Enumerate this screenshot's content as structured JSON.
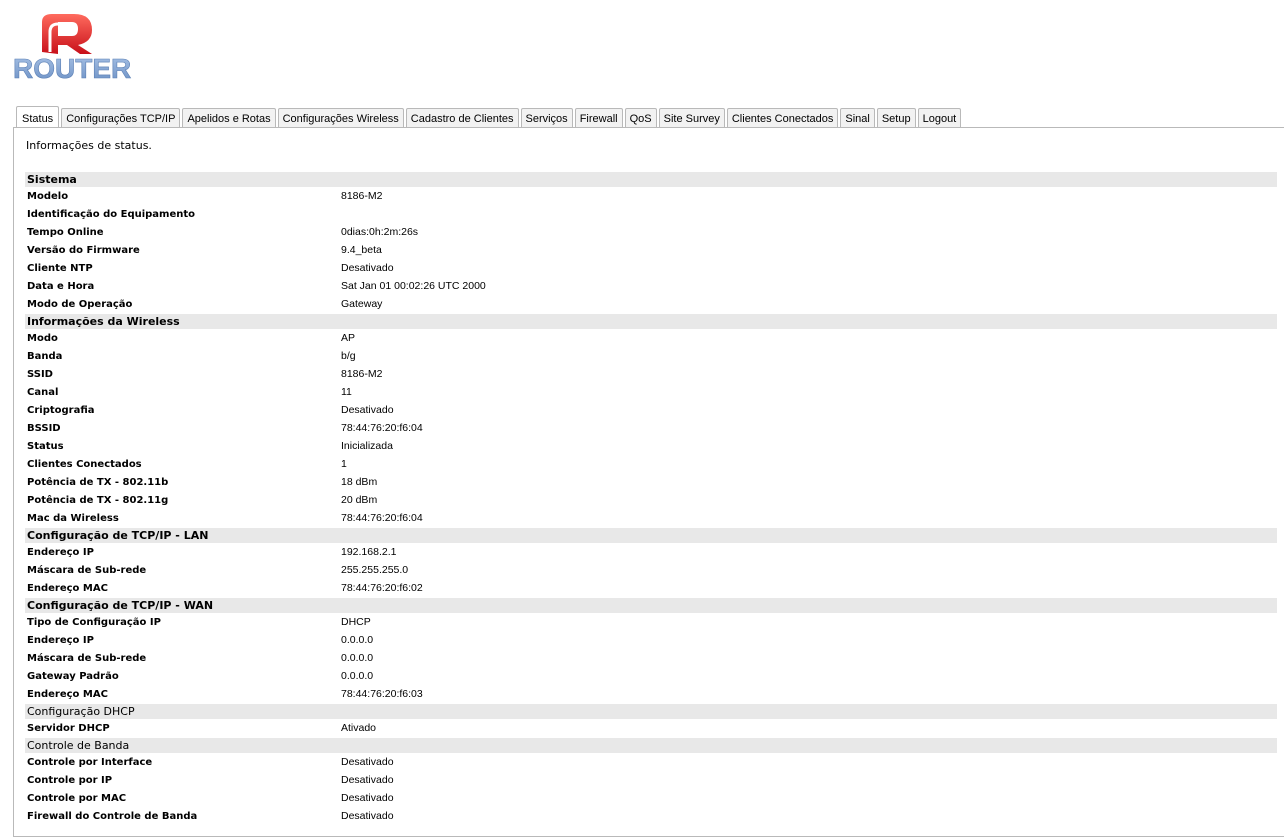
{
  "app": {
    "logo_text": "ROUTER",
    "colors": {
      "logo_red": "#e8252b",
      "logo_blue": "#7da2cf",
      "section_bg": "#e8e8e8",
      "tab_bg": "#f2f2f2",
      "tab_border": "#b9b9b9"
    }
  },
  "tabs": [
    {
      "label": "Status",
      "active": true
    },
    {
      "label": "Configurações TCP/IP"
    },
    {
      "label": "Apelidos e Rotas"
    },
    {
      "label": "Configurações Wireless"
    },
    {
      "label": "Cadastro de Clientes"
    },
    {
      "label": "Serviços"
    },
    {
      "label": "Firewall"
    },
    {
      "label": "QoS"
    },
    {
      "label": "Site Survey"
    },
    {
      "label": "Clientes Conectados"
    },
    {
      "label": "Sinal"
    },
    {
      "label": "Setup"
    },
    {
      "label": "Logout"
    }
  ],
  "intro": "Informações de status.",
  "sections": [
    {
      "title": "Sistema",
      "rows": [
        {
          "label": "Modelo",
          "value": "8186-M2"
        },
        {
          "label": "Identificação do Equipamento",
          "value": ""
        },
        {
          "label": "Tempo Online",
          "value": "0dias:0h:2m:26s"
        },
        {
          "label": "Versão do Firmware",
          "value": "9.4_beta"
        },
        {
          "label": "Cliente NTP",
          "value": "Desativado"
        },
        {
          "label": "Data e Hora",
          "value": "Sat Jan 01 00:02:26 UTC 2000"
        },
        {
          "label": "Modo de Operação",
          "value": "Gateway"
        }
      ]
    },
    {
      "title": "Informações da Wireless",
      "rows": [
        {
          "label": "Modo",
          "value": "AP"
        },
        {
          "label": "Banda",
          "value": "b/g"
        },
        {
          "label": "SSID",
          "value": "8186-M2"
        },
        {
          "label": "Canal",
          "value": "11"
        },
        {
          "label": "Criptografia",
          "value": "Desativado"
        },
        {
          "label": "BSSID",
          "value": "78:44:76:20:f6:04"
        },
        {
          "label": "Status",
          "value": "Inicializada"
        },
        {
          "label": "Clientes Conectados",
          "value": "1"
        },
        {
          "label": "Potência de TX - 802.11b",
          "value": "18 dBm"
        },
        {
          "label": "Potência de TX - 802.11g",
          "value": "20 dBm"
        },
        {
          "label": "Mac da Wireless",
          "value": "78:44:76:20:f6:04"
        }
      ]
    },
    {
      "title": "Configuração de TCP/IP - LAN",
      "rows": [
        {
          "label": "Endereço IP",
          "value": "192.168.2.1"
        },
        {
          "label": "Máscara de Sub-rede",
          "value": "255.255.255.0"
        },
        {
          "label": "Endereço MAC",
          "value": "78:44:76:20:f6:02"
        }
      ]
    },
    {
      "title": "Configuração de TCP/IP - WAN",
      "rows": [
        {
          "label": "Tipo de Configuração IP",
          "value": "DHCP"
        },
        {
          "label": "Endereço IP",
          "value": "0.0.0.0"
        },
        {
          "label": "Máscara de Sub-rede",
          "value": "0.0.0.0"
        },
        {
          "label": "Gateway Padrão",
          "value": "0.0.0.0"
        },
        {
          "label": "Endereço MAC",
          "value": "78:44:76:20:f6:03"
        }
      ]
    },
    {
      "title": "Configuração DHCP",
      "plain": true,
      "rows": [
        {
          "label": "Servidor DHCP",
          "value": "Ativado"
        }
      ]
    },
    {
      "title": "Controle de Banda",
      "plain": true,
      "rows": [
        {
          "label": "Controle por Interface",
          "value": "Desativado"
        },
        {
          "label": "Controle por IP",
          "value": "Desativado"
        },
        {
          "label": "Controle por MAC",
          "value": "Desativado"
        },
        {
          "label": "Firewall do Controle de Banda",
          "value": "Desativado"
        }
      ]
    }
  ]
}
